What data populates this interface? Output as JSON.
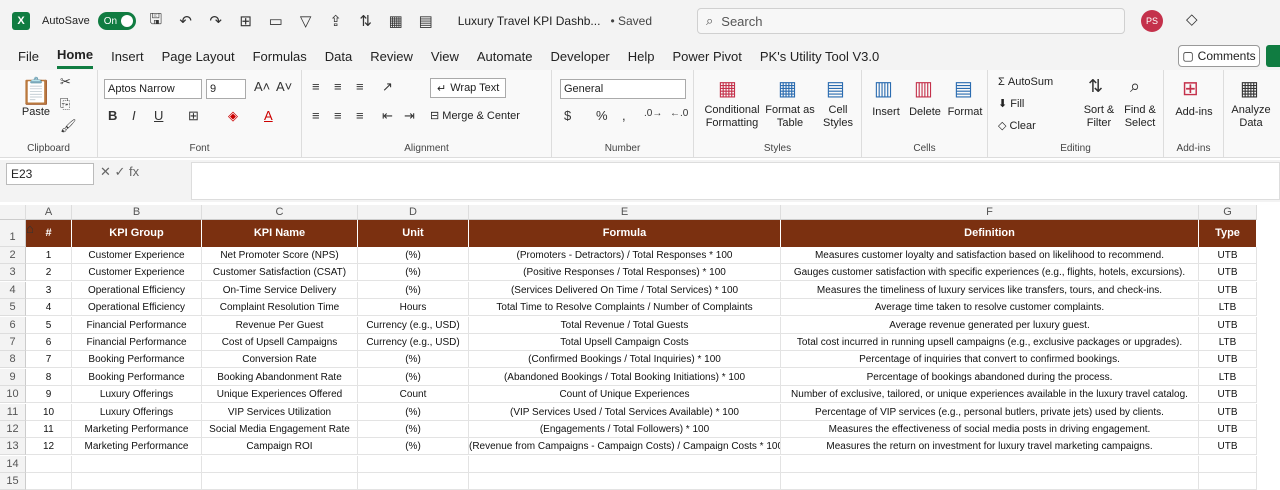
{
  "titlebar": {
    "autosave_label": "AutoSave",
    "autosave_state": "On",
    "filename": "Luxury Travel KPI Dashb...",
    "saved": "• Saved",
    "search_placeholder": "Search",
    "avatar_initials": "PS"
  },
  "menu": [
    "File",
    "Home",
    "Insert",
    "Page Layout",
    "Formulas",
    "Data",
    "Review",
    "View",
    "Automate",
    "Developer",
    "Help",
    "Power Pivot",
    "PK's Utility Tool V3.0"
  ],
  "comments_label": "Comments",
  "ribbon": {
    "paste": "Paste",
    "clipboard": "Clipboard",
    "font_name": "Aptos Narrow",
    "font_size": "9",
    "font": "Font",
    "wrap_text": "Wrap Text",
    "merge_center": "Merge & Center",
    "alignment": "Alignment",
    "number_format": "General",
    "number": "Number",
    "cond_format": "Conditional Formatting",
    "format_table": "Format as Table",
    "cell_styles": "Cell Styles",
    "styles": "Styles",
    "insert": "Insert",
    "delete": "Delete",
    "format": "Format",
    "cells": "Cells",
    "autosum": "AutoSum",
    "fill": "Fill",
    "clear": "Clear",
    "sort_filter": "Sort & Filter",
    "find_select": "Find & Select",
    "editing": "Editing",
    "addins": "Add-ins",
    "addins_group": "Add-ins",
    "analyze": "Analyze Data"
  },
  "namebox": "E23",
  "columns": [
    "A",
    "B",
    "C",
    "D",
    "E",
    "F",
    "G"
  ],
  "headers": [
    "#",
    "KPI Group",
    "KPI Name",
    "Unit",
    "Formula",
    "Definition",
    "Type"
  ],
  "rows": [
    [
      "1",
      "Customer Experience",
      "Net Promoter Score (NPS)",
      "(%)",
      "(Promoters - Detractors) / Total Responses * 100",
      "Measures customer loyalty and satisfaction based on likelihood to recommend.",
      "UTB"
    ],
    [
      "2",
      "Customer Experience",
      "Customer Satisfaction (CSAT)",
      "(%)",
      "(Positive Responses / Total Responses) * 100",
      "Gauges customer satisfaction with specific experiences (e.g., flights, hotels, excursions).",
      "UTB"
    ],
    [
      "3",
      "Operational Efficiency",
      "On-Time Service Delivery",
      "(%)",
      "(Services Delivered On Time / Total Services) * 100",
      "Measures the timeliness of luxury services like transfers, tours, and check-ins.",
      "UTB"
    ],
    [
      "4",
      "Operational Efficiency",
      "Complaint Resolution Time",
      "Hours",
      "Total Time to Resolve Complaints / Number of Complaints",
      "Average time taken to resolve customer complaints.",
      "LTB"
    ],
    [
      "5",
      "Financial Performance",
      "Revenue Per Guest",
      "Currency (e.g., USD)",
      "Total Revenue / Total Guests",
      "Average revenue generated per luxury guest.",
      "UTB"
    ],
    [
      "6",
      "Financial Performance",
      "Cost of Upsell Campaigns",
      "Currency (e.g., USD)",
      "Total Upsell Campaign Costs",
      "Total cost incurred in running upsell campaigns (e.g., exclusive packages or upgrades).",
      "LTB"
    ],
    [
      "7",
      "Booking Performance",
      "Conversion Rate",
      "(%)",
      "(Confirmed Bookings / Total Inquiries) * 100",
      "Percentage of inquiries that convert to confirmed bookings.",
      "UTB"
    ],
    [
      "8",
      "Booking Performance",
      "Booking Abandonment Rate",
      "(%)",
      "(Abandoned Bookings / Total Booking Initiations) * 100",
      "Percentage of bookings abandoned during the process.",
      "LTB"
    ],
    [
      "9",
      "Luxury Offerings",
      "Unique Experiences Offered",
      "Count",
      "Count of Unique Experiences",
      "Number of exclusive, tailored, or unique experiences available in the luxury travel catalog.",
      "UTB"
    ],
    [
      "10",
      "Luxury Offerings",
      "VIP Services Utilization",
      "(%)",
      "(VIP Services Used / Total Services Available) * 100",
      "Percentage of VIP services (e.g., personal butlers, private jets) used by clients.",
      "UTB"
    ],
    [
      "11",
      "Marketing Performance",
      "Social Media Engagement Rate",
      "(%)",
      "(Engagements / Total Followers) * 100",
      "Measures the effectiveness of social media posts in driving engagement.",
      "UTB"
    ],
    [
      "12",
      "Marketing Performance",
      "Campaign ROI",
      "(%)",
      "(Revenue from Campaigns - Campaign Costs) / Campaign Costs * 100",
      "Measures the return on investment for luxury travel marketing campaigns.",
      "UTB"
    ]
  ],
  "row_numbers": [
    "1",
    "2",
    "3",
    "4",
    "5",
    "6",
    "7",
    "8",
    "9",
    "10",
    "11",
    "12",
    "13",
    "14",
    "15"
  ],
  "header_color": "#7b3010"
}
